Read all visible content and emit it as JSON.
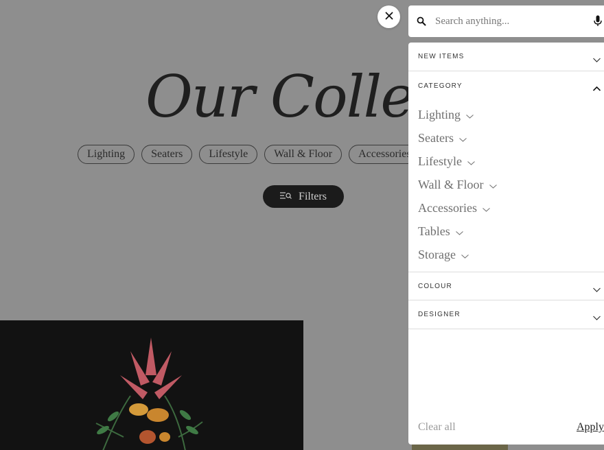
{
  "background": {
    "hero_title": "Our Collecti",
    "chips": [
      "Lighting",
      "Seaters",
      "Lifestyle",
      "Wall & Floor",
      "Accessories"
    ],
    "filters_button": "Filters"
  },
  "search": {
    "placeholder": "Search anything..."
  },
  "panel": {
    "sections": {
      "new_items": "NEW ITEMS",
      "category": "CATEGORY",
      "colour": "COLOUR",
      "designer": "DESIGNER"
    },
    "categories": [
      "Lighting",
      "Seaters",
      "Lifestyle",
      "Wall & Floor",
      "Accessories",
      "Tables",
      "Storage"
    ],
    "clear_all": "Clear all",
    "apply": "Apply"
  },
  "icons": [
    "close-icon",
    "search-icon",
    "microphone-icon",
    "chevron-down-icon",
    "chevron-up-icon",
    "filter-icon"
  ]
}
